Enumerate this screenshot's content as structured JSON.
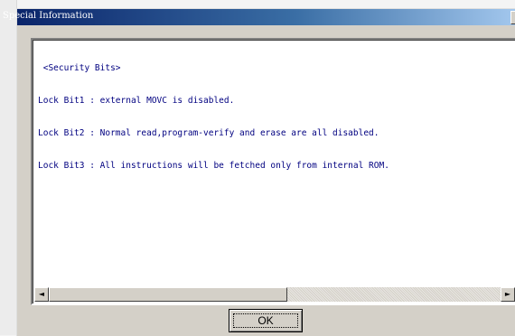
{
  "window": {
    "title": "Special Information",
    "close_glyph": "×"
  },
  "content": {
    "lines": [
      " <Security Bits>",
      "Lock Bit1 : external MOVC is disabled.",
      "Lock Bit2 : Normal read,program-verify and erase are all disabled.",
      "Lock Bit3 : All instructions will be fetched only from internal ROM."
    ]
  },
  "scrollbar": {
    "left_arrow": "◄",
    "right_arrow": "►"
  },
  "buttons": {
    "ok_label": "OK"
  },
  "colors": {
    "titlebar_start": "#0a246a",
    "titlebar_end": "#a6caf0",
    "text": "#000080",
    "dialog_face": "#d4d0c8"
  }
}
